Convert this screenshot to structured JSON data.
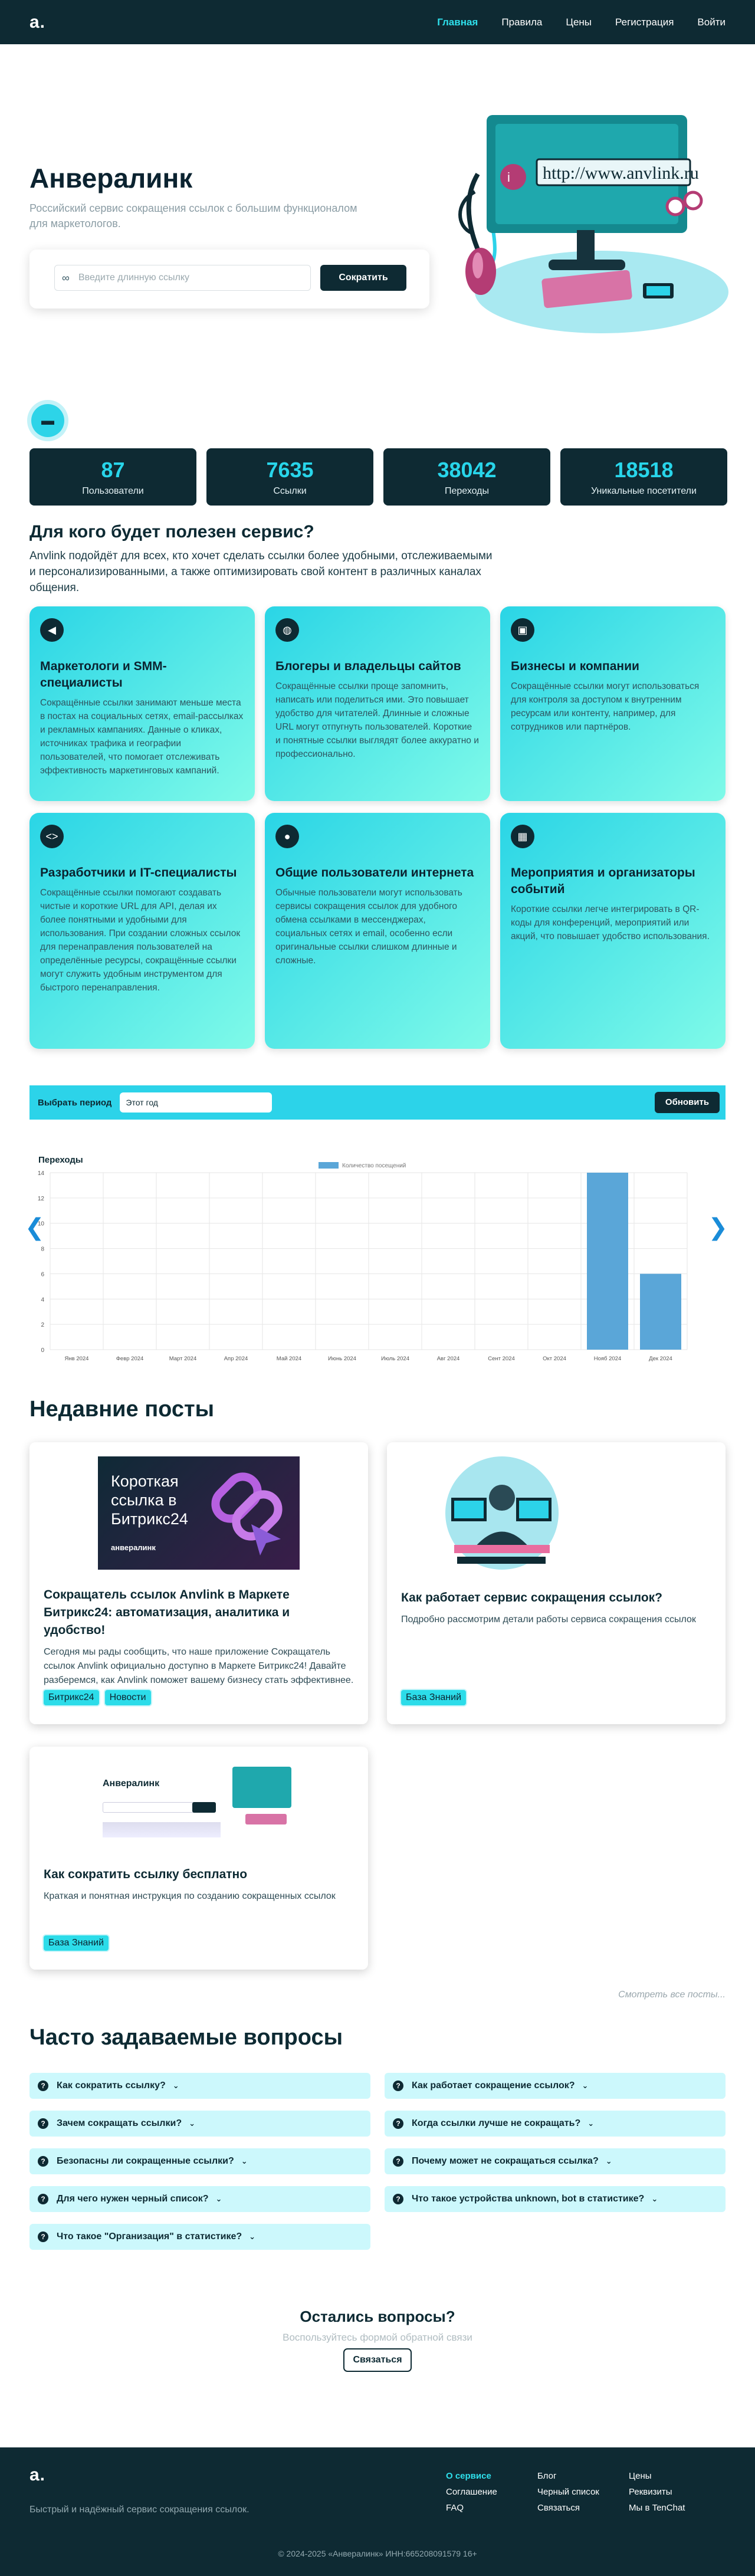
{
  "nav": {
    "logo": "a.",
    "items": [
      "Главная",
      "Правила",
      "Цены",
      "Регистрация",
      "Войти"
    ]
  },
  "hero": {
    "title": "Анвералинк",
    "subtitle": "Российский сервис сокращения ссылок с большим функционалом для маркетологов.",
    "input_placeholder": "Введите длинную ссылку",
    "button": "Сократить",
    "illustration_url_text": "http://www.anvlink.ru"
  },
  "stats": [
    {
      "value": "87",
      "label": "Пользователи"
    },
    {
      "value": "7635",
      "label": "Ссылки"
    },
    {
      "value": "38042",
      "label": "Переходы"
    },
    {
      "value": "18518",
      "label": "Уникальные посетители"
    }
  ],
  "who": {
    "title": "Для кого будет полезен сервис?",
    "intro": "Anvlink подойдёт для всех, кто хочет сделать ссылки более удобными, отслеживаемыми и персонализированными, а также оптимизировать свой контент в различных каналах общения.",
    "cards": [
      {
        "icon": "megaphone-icon",
        "title": "Маркетологи и SMM-специалисты",
        "text": "Сокращённые ссылки занимают меньше места в постах на социальных сетях, email-рассылках и рекламных кампаниях. Данные о кликах, источниках трафика и географии пользователей, что помогает отслеживать эффективность маркетинговых кампаний."
      },
      {
        "icon": "globe-icon",
        "title": "Блогеры и владельцы сайтов",
        "text": "Сокращённые ссылки проще запомнить, написать или поделиться ими. Это повышает удобство для читателей. Длинные и сложные URL могут отпугнуть пользователей. Короткие и понятные ссылки выглядят более аккуратно и профессионально."
      },
      {
        "icon": "briefcase-icon",
        "title": "Бизнесы и компании",
        "text": "Сокращённые ссылки могут использоваться для контроля за доступом к внутренним ресурсам или контенту, например, для сотрудников или партнёров."
      },
      {
        "icon": "code-icon",
        "title": "Разработчики и IT-специалисты",
        "text": "Сокращённые ссылки помогают создавать чистые и короткие URL для API, делая их более понятными и удобными для использования. При создании сложных ссылок для перенаправления пользователей на определённые ресурсы, сокращённые ссылки могут служить удобным инструментом для быстрого перенаправления."
      },
      {
        "icon": "user-icon",
        "title": "Общие пользователи интернета",
        "text": "Обычные пользователи могут использовать сервисы сокращения ссылок для удобного обмена ссылками в мессенджерах, социальных сетях и email, особенно если оригинальные ссылки слишком длинные и сложные."
      },
      {
        "icon": "calendar-icon",
        "title": "Мероприятия и организаторы событий",
        "text": "Короткие ссылки легче интегрировать в QR-коды для конференций, мероприятий или акций, что повышает удобство использования."
      }
    ]
  },
  "period": {
    "label": "Выбрать период",
    "value": "Этот год",
    "button": "Обновить"
  },
  "chart_data": {
    "type": "bar",
    "title": "Переходы",
    "legend": [
      "Количество посещений"
    ],
    "categories": [
      "Янв 2024",
      "Февр 2024",
      "Март 2024",
      "Апр 2024",
      "Май 2024",
      "Июнь 2024",
      "Июль 2024",
      "Авг 2024",
      "Сент 2024",
      "Окт 2024",
      "Нояб 2024",
      "Дек 2024"
    ],
    "series": [
      {
        "name": "Количество посещений",
        "values": [
          0,
          0,
          0,
          0,
          0,
          0,
          0,
          0,
          0,
          0,
          14,
          6
        ]
      }
    ],
    "ylim": [
      0,
      14
    ],
    "yticks": [
      0,
      2,
      4,
      6,
      8,
      10,
      12,
      14
    ],
    "color": "#5aa6d8"
  },
  "posts": {
    "title": "Недавние посты",
    "items": [
      {
        "img_title": "Короткая ссылка в Битрикс24",
        "img_brand": "анвералинк",
        "title": "Сокращатель ссылок Anvlink в Маркете Битрикс24: автоматизация, аналитика и удобство!",
        "text": "Сегодня мы рады сообщить, что наше приложение Сокращатель ссылок Anvlink официально доступно в Маркете Битрикс24! Давайте разберемся, как Anvlink поможет вашему бизнесу стать эффективнее.",
        "tags": [
          "Битрикс24",
          "Новости"
        ]
      },
      {
        "title": "Как работает сервис сокращения ссылок?",
        "text": "Подробно рассмотрим детали работы сервиса сокращения ссылок",
        "tags": [
          "База Знаний"
        ]
      },
      {
        "img_title": "Анвералинк",
        "title": "Как сократить ссылку бесплатно",
        "text": "Краткая и понятная инструкция по созданию сокращенных ссылок",
        "tags": [
          "База Знаний"
        ]
      }
    ],
    "all": "Смотреть все посты..."
  },
  "faq": {
    "title": "Часто задаваемые вопросы",
    "items": [
      "Как сократить ссылку?",
      "Как работает сокращение ссылок?",
      "Зачем сокращать ссылки?",
      "Когда ссылки лучше не сокращать?",
      "Безопасны ли сокращенные ссылки?",
      "Почему может не сокращаться ссылка?",
      "Для чего нужен черный список?",
      "Что такое устройства unknown, bot в статистике?",
      "Что такое \"Организация\" в статистике?"
    ]
  },
  "contact": {
    "title": "Остались вопросы?",
    "text": "Воспользуйтесь формой обратной связи",
    "button": "Связаться"
  },
  "footer": {
    "logo": "a.",
    "tagline": "Быстрый и надёжный сервис сокращения ссылок.",
    "links": [
      "О сервисе",
      "Блог",
      "Цены",
      "Соглашение",
      "Черный список",
      "Реквизиты",
      "FAQ",
      "Связаться",
      "Мы в TenChat"
    ],
    "copyright": "© 2024-2025 «Анвералинк» ИНН:665208091579 16+"
  },
  "colors": {
    "dark": "#0e2a33",
    "accent": "#2cd3e9"
  }
}
